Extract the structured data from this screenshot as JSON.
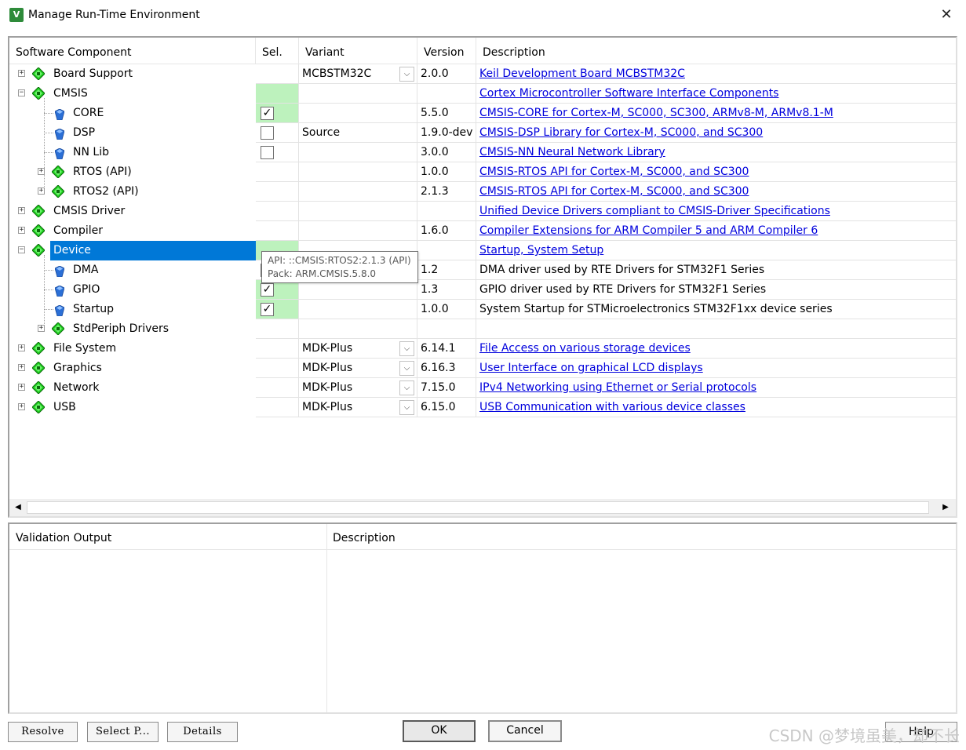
{
  "window": {
    "title": "Manage Run-Time Environment",
    "icon_label": "V",
    "close_glyph": "✕"
  },
  "grid": {
    "headers": {
      "component": "Software Component",
      "sel": "Sel.",
      "variant": "Variant",
      "version": "Version",
      "description": "Description"
    },
    "rows": [
      {
        "label": "Board Support",
        "level": 0,
        "expander": "+",
        "icon": "component-diamond-icon",
        "sel": "",
        "variant": "MCBSTM32C",
        "dropdown": true,
        "version": "2.0.0",
        "description": "Keil Development Board MCBSTM32C",
        "link": true
      },
      {
        "label": "CMSIS",
        "level": 0,
        "expander": "−",
        "icon": "component-diamond-icon",
        "sel": "green",
        "variant": "",
        "dropdown": false,
        "version": "",
        "description": "Cortex Microcontroller Software Interface Components",
        "link": true
      },
      {
        "label": "CORE",
        "level": 1,
        "expander": "",
        "icon": "blue-gem-icon",
        "sel": "checked-green",
        "variant": "",
        "dropdown": false,
        "version": "5.5.0",
        "description": "CMSIS-CORE for Cortex-M, SC000, SC300, ARMv8-M, ARMv8.1-M",
        "link": true
      },
      {
        "label": "DSP",
        "level": 1,
        "expander": "",
        "icon": "blue-gem-icon",
        "sel": "unchecked",
        "variant": "Source",
        "dropdown": false,
        "version": "1.9.0-dev",
        "description": "CMSIS-DSP Library for Cortex-M, SC000, and SC300",
        "link": true
      },
      {
        "label": "NN Lib",
        "level": 1,
        "expander": "",
        "icon": "blue-gem-icon",
        "sel": "unchecked",
        "variant": "",
        "dropdown": false,
        "version": "3.0.0",
        "description": "CMSIS-NN Neural Network Library",
        "link": true
      },
      {
        "label": "RTOS (API)",
        "level": 1,
        "expander": "+",
        "icon": "component-diamond-icon",
        "sel": "",
        "variant": "",
        "dropdown": false,
        "version": "1.0.0",
        "description": "CMSIS-RTOS API for Cortex-M, SC000, and SC300",
        "link": true
      },
      {
        "label": "RTOS2 (API)",
        "level": 1,
        "expander": "+",
        "icon": "component-diamond-icon",
        "sel": "",
        "variant": "",
        "dropdown": false,
        "version": "2.1.3",
        "description": "CMSIS-RTOS API for Cortex-M, SC000, and SC300",
        "link": true
      },
      {
        "label": "CMSIS Driver",
        "level": 0,
        "expander": "+",
        "icon": "component-diamond-icon",
        "sel": "",
        "variant": "",
        "dropdown": false,
        "version": "",
        "description": "Unified Device Drivers compliant to CMSIS-Driver Specifications",
        "link": true
      },
      {
        "label": "Compiler",
        "level": 0,
        "expander": "+",
        "icon": "component-diamond-icon",
        "sel": "",
        "variant": "",
        "dropdown": false,
        "version": "1.6.0",
        "description": "Compiler Extensions for ARM Compiler 5 and ARM Compiler 6",
        "link": true
      },
      {
        "label": "Device",
        "level": 0,
        "expander": "−",
        "icon": "component-diamond-icon",
        "sel": "green",
        "variant": "",
        "dropdown": false,
        "version": "",
        "description": "Startup, System Setup",
        "link": true,
        "selected": true
      },
      {
        "label": "DMA",
        "level": 1,
        "expander": "",
        "icon": "blue-gem-icon",
        "sel": "unchecked",
        "variant": "",
        "dropdown": false,
        "version": "1.2",
        "description": "DMA driver used by RTE Drivers for STM32F1 Series",
        "link": false
      },
      {
        "label": "GPIO",
        "level": 1,
        "expander": "",
        "icon": "blue-gem-icon",
        "sel": "checked-green",
        "variant": "",
        "dropdown": false,
        "version": "1.3",
        "description": "GPIO driver used by RTE Drivers for STM32F1 Series",
        "link": false
      },
      {
        "label": "Startup",
        "level": 1,
        "expander": "",
        "icon": "blue-gem-icon",
        "sel": "checked-green",
        "variant": "",
        "dropdown": false,
        "version": "1.0.0",
        "description": "System Startup for STMicroelectronics STM32F1xx device series",
        "link": false
      },
      {
        "label": "StdPeriph Drivers",
        "level": 1,
        "expander": "+",
        "icon": "component-diamond-icon",
        "sel": "",
        "variant": "",
        "dropdown": false,
        "version": "",
        "description": "",
        "link": false
      },
      {
        "label": "File System",
        "level": 0,
        "expander": "+",
        "icon": "component-diamond-icon",
        "sel": "",
        "variant": "MDK-Plus",
        "dropdown": true,
        "version": "6.14.1",
        "description": "File Access on various storage devices",
        "link": true
      },
      {
        "label": "Graphics",
        "level": 0,
        "expander": "+",
        "icon": "component-diamond-icon",
        "sel": "",
        "variant": "MDK-Plus",
        "dropdown": true,
        "version": "6.16.3",
        "description": "User Interface on graphical LCD displays",
        "link": true
      },
      {
        "label": "Network",
        "level": 0,
        "expander": "+",
        "icon": "component-diamond-icon",
        "sel": "",
        "variant": "MDK-Plus",
        "dropdown": true,
        "version": "7.15.0",
        "description": "IPv4 Networking using Ethernet or Serial protocols",
        "link": true
      },
      {
        "label": "USB",
        "level": 0,
        "expander": "+",
        "icon": "component-diamond-icon",
        "sel": "",
        "variant": "MDK-Plus",
        "dropdown": true,
        "version": "6.15.0",
        "description": "USB Communication with various device classes",
        "link": true
      }
    ]
  },
  "tooltip": {
    "line1": "API: ::CMSIS:RTOS2:2.1.3 (API)",
    "line2": "Pack: ARM.CMSIS.5.8.0"
  },
  "validation": {
    "headers": {
      "output": "Validation Output",
      "description": "Description"
    }
  },
  "buttons": {
    "resolve": "Resolve",
    "select_packs": "Select P...",
    "details": "Details",
    "ok": "OK",
    "cancel": "Cancel",
    "help": "Help"
  },
  "watermark": "CSDN @梦境虽美，却不长",
  "colors": {
    "selection": "#0078d7",
    "sel_green": "#bdf2bd",
    "link": "#0000dd",
    "component_green": "#1fd01f"
  }
}
